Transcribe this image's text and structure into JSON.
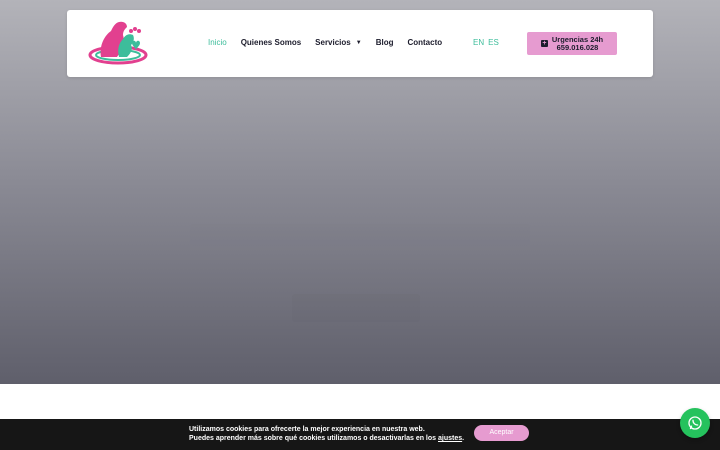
{
  "header": {
    "logo_icon": "vet-clinic-logo-icon",
    "nav": [
      {
        "label": "Inicio",
        "active": true
      },
      {
        "label": "Quienes Somos",
        "active": false
      },
      {
        "label": "Servicios",
        "active": false,
        "has_dropdown": true
      },
      {
        "label": "Blog",
        "active": false
      },
      {
        "label": "Contacto",
        "active": false
      }
    ],
    "languages": [
      "EN",
      "ES"
    ],
    "urgent_button": {
      "line1": "Urgencias 24h",
      "line2": "659.016.028",
      "icon": "plus-square-icon"
    }
  },
  "cookie_bar": {
    "line1": "Utilizamos cookies para ofrecerte la mejor experiencia en nuestra web.",
    "line2_prefix": "Puedes aprender más sobre qué cookies utilizamos o desactivarlas en los ",
    "link": "ajustes",
    "line2_suffix": ".",
    "accept_label": "Aceptar"
  },
  "whatsapp": {
    "icon": "whatsapp-icon"
  },
  "colors": {
    "accent_green": "#3dbd9b",
    "accent_pink": "#e69bd0",
    "nav_text": "#1c1c2c",
    "cookie_bg": "#161616",
    "whatsapp_green": "#25c25d"
  }
}
